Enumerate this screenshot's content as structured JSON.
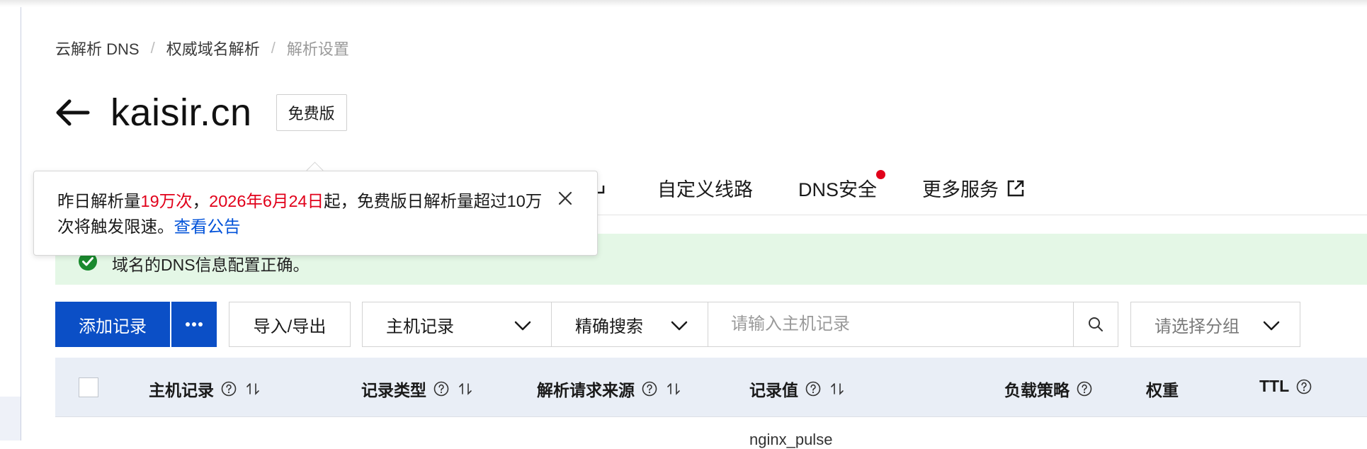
{
  "breadcrumb": [
    "云解析 DNS",
    "权威域名解析",
    "解析设置"
  ],
  "breadcrumb_sep": "/",
  "domain": {
    "name": "kaisir.cn",
    "plan": "免费版"
  },
  "tooltip": {
    "part1": "昨日解析量",
    "highlight1": "19万次",
    "part2": "，",
    "highlight2": "2026年6月24日",
    "part3": "起，免费版日解析量超过10万次将触发限速。",
    "link": "查看公告"
  },
  "tabs": [
    {
      "label": "自定义线路",
      "external": false,
      "dot": false
    },
    {
      "label": "DNS安全",
      "external": false,
      "dot": true
    },
    {
      "label": "更多服务",
      "external": true,
      "dot": false
    }
  ],
  "status": {
    "text": "域名的DNS信息配置正确。"
  },
  "toolbar": {
    "add_label": "添加记录",
    "io_label": "导入/导出",
    "field_select": "主机记录",
    "match_select": "精确搜索",
    "search_placeholder": "请输入主机记录",
    "group_select": "请选择分组"
  },
  "table": {
    "columns": [
      {
        "label": "主机记录",
        "help": true,
        "sort": true
      },
      {
        "label": "记录类型",
        "help": true,
        "sort": true
      },
      {
        "label": "解析请求来源",
        "help": true,
        "sort": true
      },
      {
        "label": "记录值",
        "help": true,
        "sort": true
      },
      {
        "label": "负载策略",
        "help": true,
        "sort": false
      },
      {
        "label": "权重",
        "help": false,
        "sort": false
      },
      {
        "label": "TTL",
        "help": true,
        "sort": false
      }
    ],
    "first_row_value_partial": "nginx_pulse"
  },
  "colors": {
    "primary": "#0b4fc6",
    "danger": "#e1001a",
    "link": "#0052d9",
    "success_bg": "#e4f7e6",
    "success_icon": "#1a8a2e",
    "header_bg": "#e9eef6"
  }
}
